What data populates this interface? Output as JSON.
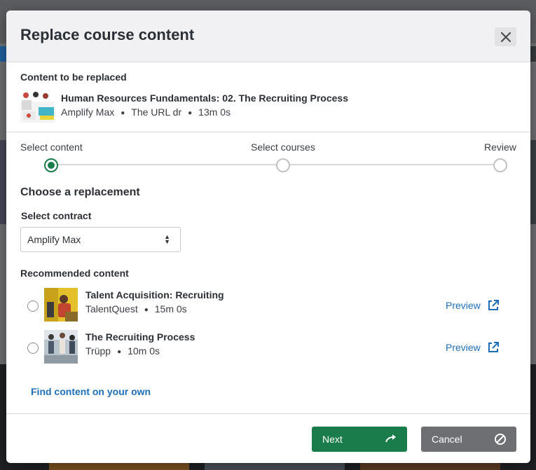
{
  "modal": {
    "title": "Replace course content",
    "close_icon": "close-icon"
  },
  "current": {
    "label": "Content to be replaced",
    "title": "Human Resources Fundamentals: 02. The Recruiting Process",
    "provider": "Amplify Max",
    "detail": "The URL dr",
    "duration": "13m 0s"
  },
  "stepper": {
    "steps": [
      "Select content",
      "Select courses",
      "Review"
    ],
    "active_index": 0,
    "active_color": "#1b7c4b"
  },
  "choose": {
    "title": "Choose a replacement",
    "contract_label": "Select contract",
    "contract_value": "Amplify Max",
    "recommended_label": "Recommended content"
  },
  "recommended": [
    {
      "title": "Talent Acquisition: Recruiting",
      "provider": "TalentQuest",
      "duration": "15m 0s",
      "preview": "Preview"
    },
    {
      "title": "The Recruiting Process",
      "provider": "Trüpp",
      "duration": "10m 0s",
      "preview": "Preview"
    }
  ],
  "find_link": "Find content on your own",
  "buttons": {
    "next": "Next",
    "cancel": "Cancel"
  },
  "colors": {
    "primary_green": "#1b7c4b",
    "link_blue": "#1d6fba",
    "cancel_gray": "#6e6f72"
  }
}
